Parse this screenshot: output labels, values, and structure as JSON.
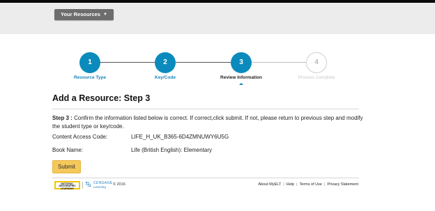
{
  "header": {
    "resources_button": "Your Resources",
    "caret_icon": "chevron-down-icon"
  },
  "stepper": {
    "steps": [
      {
        "number": "1",
        "label": "Resource Type",
        "state": "completed"
      },
      {
        "number": "2",
        "label": "Key/Code",
        "state": "completed"
      },
      {
        "number": "3",
        "label": "Review Information",
        "state": "active"
      },
      {
        "number": "4",
        "label": "Process Complete",
        "state": "pending"
      }
    ],
    "accent_color": "#0b8bbd"
  },
  "main": {
    "title": "Add a Resource: Step 3",
    "instruction_prefix": "Step 3 :",
    "instruction_text": " Confirm the information listed below is correct. If correct,click submit. If not, please return to previous step and modify the student type or key/code.",
    "fields": [
      {
        "label": "Content Access Code:",
        "value": "LIFE_H_UK_B365-6D4ZMNUWY6U5G"
      },
      {
        "label": "Book Name:",
        "value": "Life (British English): Elementary"
      }
    ],
    "submit_label": "Submit",
    "submit_color": "#f6c85a"
  },
  "footer": {
    "natgeo_logo": [
      "NATIONAL",
      "GEOGRAPHIC",
      "LEARNING"
    ],
    "cengage_name": "CENGAGE",
    "cengage_sub": "Learning",
    "copyright": "© 2016",
    "links": [
      "About MyELT",
      "Help",
      "Terms of Use",
      "Privacy Statement"
    ]
  }
}
